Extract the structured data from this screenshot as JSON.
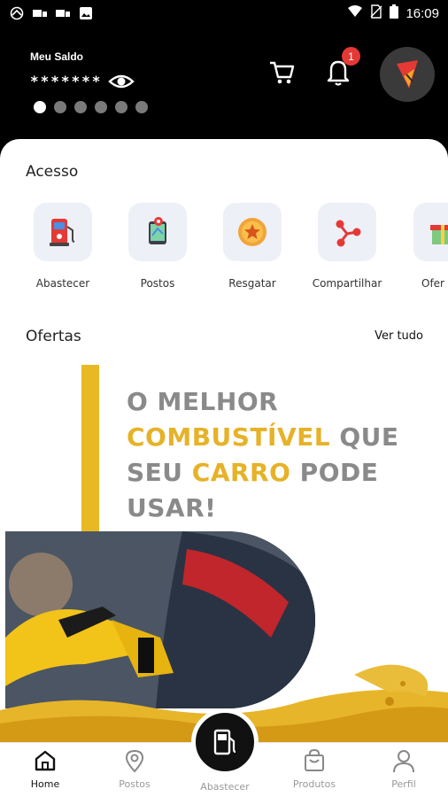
{
  "status_bar": {
    "time": "16:09",
    "icons": [
      "system-logo-icon",
      "notification-icon-1",
      "notification-icon-2",
      "image-icon",
      "wifi-icon",
      "no-sim-icon",
      "battery-icon"
    ]
  },
  "header": {
    "balance_label": "Meu Saldo",
    "balance_value": "*******",
    "carousel_total": 6,
    "carousel_active": 0,
    "notification_count": "1"
  },
  "acesso": {
    "title": "Acesso",
    "items": [
      {
        "label": "Abastecer",
        "icon": "fuel-pump-icon"
      },
      {
        "label": "Postos",
        "icon": "map-pin-icon"
      },
      {
        "label": "Resgatar",
        "icon": "coin-star-icon"
      },
      {
        "label": "Compartilhar",
        "icon": "share-icon"
      },
      {
        "label": "Ofer",
        "icon": "gift-icon"
      }
    ]
  },
  "ofertas": {
    "title": "Ofertas",
    "see_all": "Ver tudo",
    "banner": {
      "line1": "O MELHOR",
      "line2_highlight": "COMBUSTÍVEL",
      "line2_rest": " QUE",
      "line3_start": "SEU ",
      "line3_highlight": "CARRO",
      "line3_rest": " PODE",
      "line4": "USAR!"
    }
  },
  "bottom_nav": {
    "items": [
      {
        "label": "Home",
        "icon": "home-icon",
        "active": true
      },
      {
        "label": "Postos",
        "icon": "map-pin-icon",
        "active": false
      },
      {
        "label": "Abastecer",
        "icon": "fuel-pump-icon",
        "active": false
      },
      {
        "label": "Produtos",
        "icon": "shopping-bag-icon",
        "active": false
      },
      {
        "label": "Perfil",
        "icon": "user-icon",
        "active": false
      }
    ]
  },
  "colors": {
    "accent": "#e8b925",
    "badge": "#e53935",
    "quick_bg": "#eef0f7"
  }
}
